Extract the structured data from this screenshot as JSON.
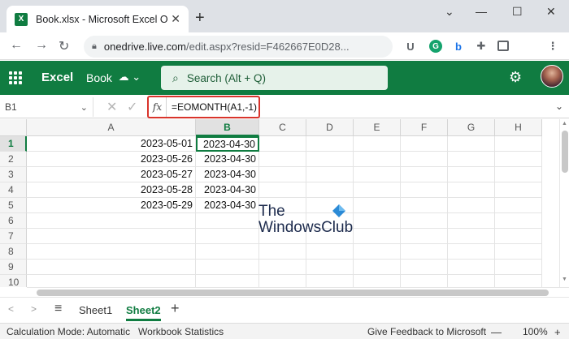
{
  "browser": {
    "tab_title": "Book.xlsx - Microsoft Excel Online",
    "tab_favicon_letter": "X",
    "url_host": "onedrive.live.com",
    "url_path": "/edit.aspx?resid=F462667E0D28...",
    "window_controls": [
      "⌄",
      "—",
      "☐",
      "✕"
    ]
  },
  "excel": {
    "app_name": "Excel",
    "doc_name": "Book",
    "search_placeholder": "Search (Alt + Q)"
  },
  "formula_bar": {
    "name_box": "B1",
    "fx_label": "fx",
    "formula": "=EOMONTH(A1,-1)"
  },
  "grid": {
    "columns": [
      "A",
      "B",
      "C",
      "D",
      "E",
      "F",
      "G",
      "H"
    ],
    "selected_column": "B",
    "rows": [
      "1",
      "2",
      "3",
      "4",
      "5",
      "6",
      "7",
      "8",
      "9",
      "10"
    ],
    "selected_row": "1",
    "data": [
      {
        "a": "2023-05-01",
        "b": "2023-04-30"
      },
      {
        "a": "2023-05-26",
        "b": "2023-04-30"
      },
      {
        "a": "2023-05-27",
        "b": "2023-04-30"
      },
      {
        "a": "2023-05-28",
        "b": "2023-04-30"
      },
      {
        "a": "2023-05-29",
        "b": "2023-04-30"
      }
    ]
  },
  "watermark": {
    "line1": "The",
    "line2": "WindowsClub"
  },
  "sheets": {
    "tabs": [
      "Sheet1",
      "Sheet2"
    ],
    "active": "Sheet2"
  },
  "status": {
    "calc_mode": "Calculation Mode: Automatic",
    "workbook_stats": "Workbook Statistics",
    "feedback": "Give Feedback to Microsoft",
    "zoom": "100%"
  },
  "colors": {
    "excel_green": "#107c41",
    "highlight_red": "#d9342b"
  }
}
